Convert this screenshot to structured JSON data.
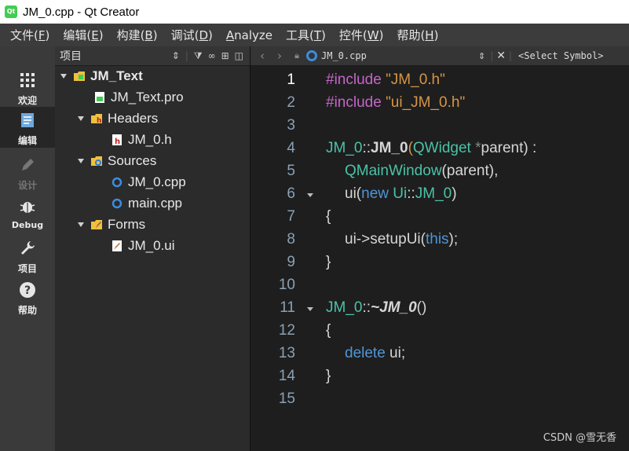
{
  "window": {
    "title": "JM_0.cpp - Qt Creator",
    "app_icon": "qt-icon",
    "app_icon_text": "Qt"
  },
  "menubar": [
    {
      "label": "文件(",
      "key": "F",
      "close": ")"
    },
    {
      "label": "编辑(",
      "key": "E",
      "close": ")"
    },
    {
      "label": "构建(",
      "key": "B",
      "close": ")"
    },
    {
      "label": "调试(",
      "key": "D",
      "close": ")"
    },
    {
      "label": "",
      "key": "A",
      "close": "nalyze"
    },
    {
      "label": "工具(",
      "key": "T",
      "close": ")"
    },
    {
      "label": "控件(",
      "key": "W",
      "close": ")"
    },
    {
      "label": "帮助(",
      "key": "H",
      "close": ")"
    }
  ],
  "modes": [
    {
      "label": "欢迎",
      "icon": "grid-icon",
      "active": false,
      "disabled": false
    },
    {
      "label": "编辑",
      "icon": "document-icon",
      "active": true,
      "disabled": false
    },
    {
      "label": "设计",
      "icon": "pencil-icon",
      "active": false,
      "disabled": true
    },
    {
      "label": "Debug",
      "icon": "bug-icon",
      "active": false,
      "disabled": false
    },
    {
      "label": "项目",
      "icon": "wrench-icon",
      "active": false,
      "disabled": false
    },
    {
      "label": "帮助",
      "icon": "help-icon",
      "active": false,
      "disabled": false
    }
  ],
  "project_panel": {
    "title": "项目",
    "tree": [
      {
        "label": "JM_Text",
        "icon": "project-folder-icon",
        "level": 0,
        "expanded": true,
        "bold": true
      },
      {
        "label": "JM_Text.pro",
        "icon": "pro-file-icon",
        "level": 1
      },
      {
        "label": "Headers",
        "icon": "headers-folder-icon",
        "level": 1,
        "expanded": true
      },
      {
        "label": "JM_0.h",
        "icon": "header-file-icon",
        "level": 2
      },
      {
        "label": "Sources",
        "icon": "sources-folder-icon",
        "level": 1,
        "expanded": true
      },
      {
        "label": "JM_0.cpp",
        "icon": "cpp-file-icon",
        "level": 2
      },
      {
        "label": "main.cpp",
        "icon": "cpp-file-icon",
        "level": 2
      },
      {
        "label": "Forms",
        "icon": "forms-folder-icon",
        "level": 1,
        "expanded": true
      },
      {
        "label": "JM_0.ui",
        "icon": "ui-file-icon",
        "level": 2
      }
    ]
  },
  "editor": {
    "file_name": "JM_0.cpp",
    "symbol_selector": "<Select Symbol>",
    "current_line": 1,
    "lines": [
      {
        "n": "1"
      },
      {
        "n": "2"
      },
      {
        "n": "3"
      },
      {
        "n": "4"
      },
      {
        "n": "5"
      },
      {
        "n": "6",
        "fold": true
      },
      {
        "n": "7"
      },
      {
        "n": "8"
      },
      {
        "n": "9"
      },
      {
        "n": "10"
      },
      {
        "n": "11",
        "fold": true
      },
      {
        "n": "12"
      },
      {
        "n": "13"
      },
      {
        "n": "14"
      },
      {
        "n": "15"
      }
    ],
    "code": {
      "l1_directive": "#include ",
      "l1_string": "\"JM_0.h\"",
      "l2_directive": "#include ",
      "l2_string": "\"ui_JM_0.h\"",
      "l4_class": "JM_0",
      "l4_scope": "::",
      "l4_func": "JM_0",
      "l4_open": "(",
      "l4_type": "QWidget",
      "l4_ptr": " *",
      "l4_param": "parent",
      "l4_close": ") :",
      "l5_base": "QMainWindow",
      "l5_args": "(parent),",
      "l6_member": "ui(",
      "l6_new": "new",
      "l6_sp": " ",
      "l6_ns": "Ui",
      "l6_scope": "::",
      "l6_cls": "JM_0",
      "l6_close": ")",
      "l7": "{",
      "l8_call": "ui->setupUi(",
      "l8_this": "this",
      "l8_end": ");",
      "l9": "}",
      "l11_class": "JM_0",
      "l11_scope": "::",
      "l11_dtor": "~JM_0",
      "l11_parens": "()",
      "l12": "{",
      "l13_kw": "delete",
      "l13_rest": " ui;",
      "l14": "}"
    }
  },
  "watermark": "CSDN @雪无香",
  "colors": {
    "preprocessor": "#c466c8",
    "string": "#d69545",
    "type": "#4bc2a7",
    "keyword": "#4f95d8",
    "text": "#d6d6d6",
    "editor_bg": "#1e1e1e",
    "sidebar_bg": "#3a3a3a"
  }
}
